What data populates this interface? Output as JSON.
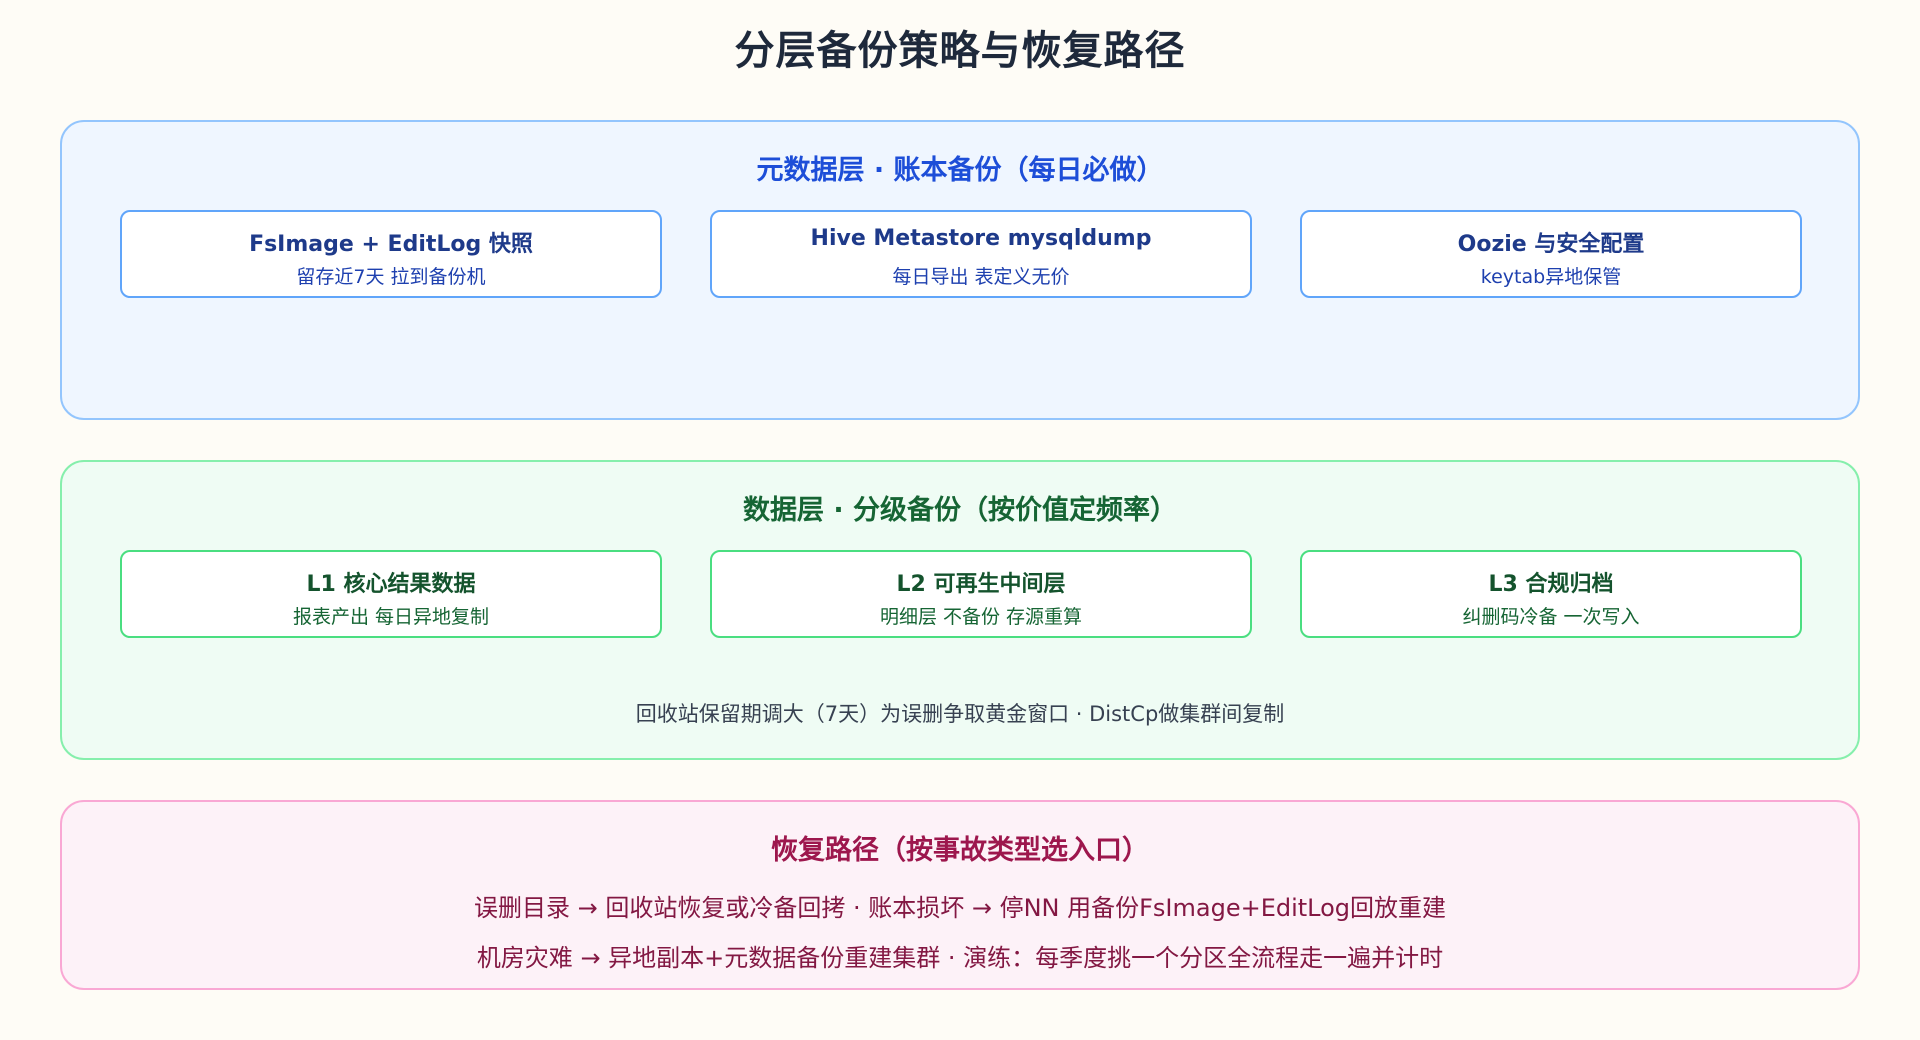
{
  "title": "分层备份策略与恢复路径",
  "metadata_layer": {
    "title": "元数据层 · 账本备份（每日必做）",
    "cards": [
      {
        "title": "FsImage + EditLog 快照",
        "subtitle": "留存近7天 拉到备份机"
      },
      {
        "title": "Hive Metastore mysqldump",
        "subtitle": "每日导出 表定义无价"
      },
      {
        "title": "Oozie 与安全配置",
        "subtitle": "keytab异地保管"
      }
    ]
  },
  "data_layer": {
    "title": "数据层 · 分级备份（按价值定频率）",
    "cards": [
      {
        "title": "L1 核心结果数据",
        "subtitle": "报表产出 每日异地复制"
      },
      {
        "title": "L2 可再生中间层",
        "subtitle": "明细层 不备份 存源重算"
      },
      {
        "title": "L3 合规归档",
        "subtitle": "纠删码冷备 一次写入"
      }
    ],
    "note": "回收站保留期调大（7天）为误删争取黄金窗口 · DistCp做集群间复制"
  },
  "recovery": {
    "title": "恢复路径（按事故类型选入口）",
    "line1": "误删目录 → 回收站恢复或冷备回拷 · 账本损坏 → 停NN 用备份FsImage+EditLog回放重建",
    "line2": "机房灾难 → 异地副本+元数据备份重建集群 · 演练：每季度挑一个分区全流程走一遍并计时"
  },
  "colors": {
    "metadata_accent": "#1d4ed8",
    "data_accent": "#166534",
    "recovery_accent": "#9d174d"
  }
}
